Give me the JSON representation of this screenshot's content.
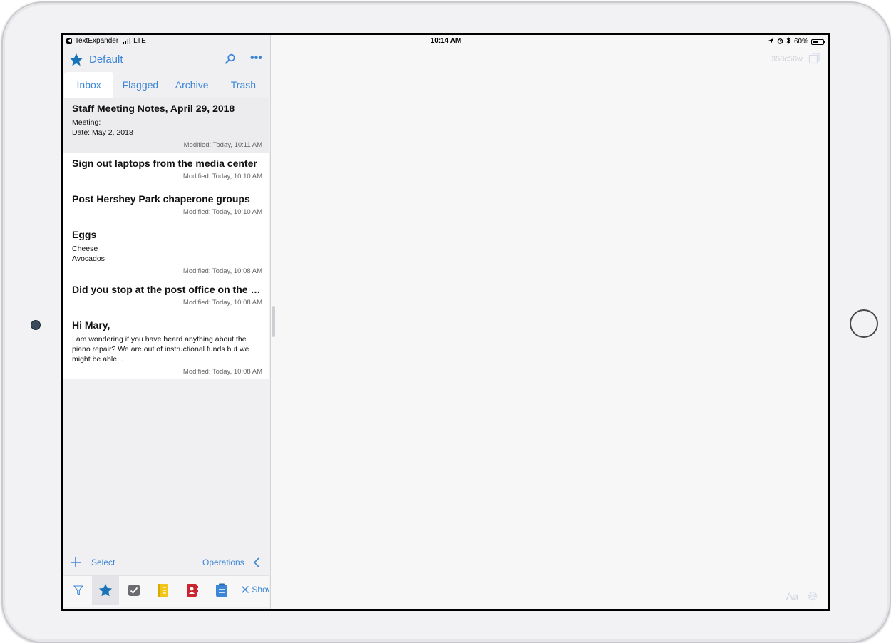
{
  "status": {
    "app": "TextExpander",
    "carrier": "LTE",
    "time": "10:14 AM",
    "battery": "60%",
    "battery_level": 0.6
  },
  "header": {
    "title": "Default"
  },
  "tabs": [
    {
      "label": "Inbox",
      "active": true
    },
    {
      "label": "Flagged"
    },
    {
      "label": "Archive"
    },
    {
      "label": "Trash"
    }
  ],
  "notes": [
    {
      "title": "Staff Meeting Notes, April 29, 2018",
      "lines": [
        "Meeting:",
        "Date: May 2, 2018"
      ],
      "modified": "Modified: Today, 10:11 AM"
    },
    {
      "title": "Sign out laptops from the media center",
      "lines": [],
      "modified": "Modified: Today, 10:10 AM"
    },
    {
      "title": "Post Hershey Park chaperone groups",
      "lines": [],
      "modified": "Modified: Today, 10:10 AM"
    },
    {
      "title": "Eggs",
      "lines": [
        "Cheese",
        "Avocados"
      ],
      "modified": "Modified: Today, 10:08 AM"
    },
    {
      "title": "Did you stop at the post office on the wa...",
      "lines": [],
      "modified": "Modified: Today, 10:08 AM"
    },
    {
      "title": "Hi Mary,",
      "lines": [
        "I am wondering if you have heard anything about the piano repair? We are out of instructional funds but we might be able..."
      ],
      "modified": "Modified: Today, 10:08 AM"
    }
  ],
  "bottom": {
    "select": "Select",
    "operations": "Operations"
  },
  "toolbar": {
    "show": "Show"
  },
  "editor": {
    "id": "358c56w",
    "font_label": "Aa"
  },
  "colors": {
    "accent": "#3d86d6",
    "star": "#1a73b8"
  }
}
